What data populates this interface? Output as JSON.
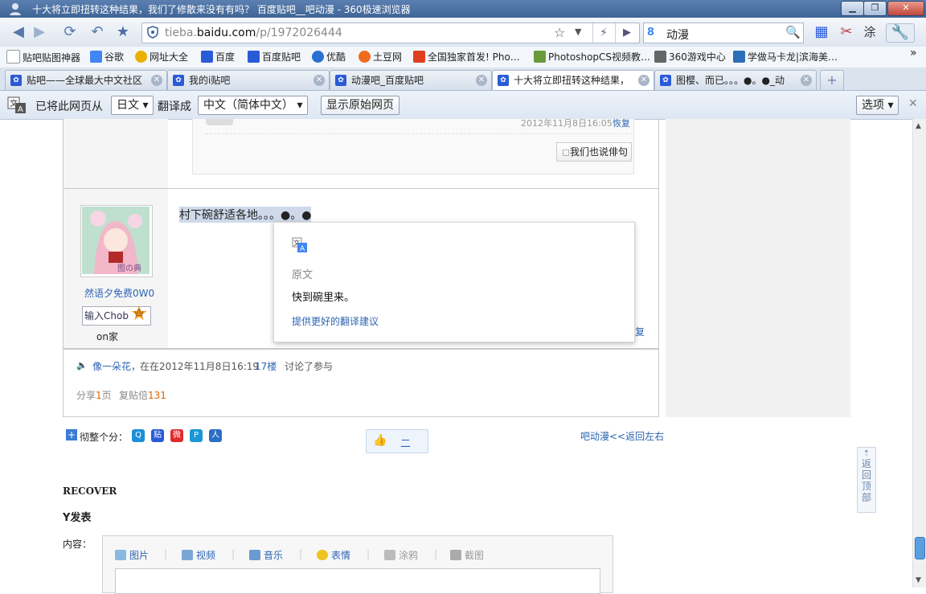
{
  "window": {
    "title": "十大将立即扭转这种结果，我们了修散来没有有吗？ 百度贴吧__吧动漫 - 360极速浏览器",
    "min_label": "▁",
    "max_label": "❐",
    "close_label": "✕"
  },
  "navbar": {
    "url_gray_prefix": "tieba.",
    "url_domain": "baidu.com",
    "url_path": "/p/1972026444",
    "search_engine_letter": "8",
    "search_query": "动漫"
  },
  "bookmarks": [
    {
      "label": "贴吧贴图神器",
      "color": "#ffffff"
    },
    {
      "label": "谷歌",
      "color": "#4285f4"
    },
    {
      "label": "网址大全",
      "color": "#e8b100"
    },
    {
      "label": "百度",
      "color": "#2a5bd7"
    },
    {
      "label": "百度贴吧",
      "color": "#2a5bd7"
    },
    {
      "label": "优酷",
      "color": "#2a6fd4"
    },
    {
      "label": "土豆网",
      "color": "#f26b1d"
    },
    {
      "label": "全国独家首发! Pho…",
      "color": "#e04020"
    },
    {
      "label": "PhotoshopCS视频教…",
      "color": "#6a9b3a"
    },
    {
      "label": "360游戏中心",
      "color": "#666666"
    },
    {
      "label": "学做马卡龙|滨海美…",
      "color": "#2b6fb8"
    }
  ],
  "bookmarks_more": "»",
  "tabs": [
    {
      "label": "贴吧——全球最大中文社区"
    },
    {
      "label": "我的i贴吧"
    },
    {
      "label": "动漫吧_百度贴吧"
    },
    {
      "label": "十大将立即扭转这种结果，"
    },
    {
      "label": "图樱、而已。。。●。●_动"
    }
  ],
  "tab_close": "✕",
  "tab_new": "+",
  "translate_bar": {
    "prefix": "已将此网页从",
    "from_lang": "日文",
    "middle": "翻译成",
    "to_lang": "中文（简体中文）",
    "show_original": "显示原始网页",
    "options": "选项",
    "close": "✕"
  },
  "prev_post": {
    "timestamp": "2012年11月8日16:05",
    "reply": "恢复",
    "say_button": "我们也说俳句"
  },
  "post": {
    "username": "然语夕免费0W0",
    "badge_label": "输入Chob",
    "badge_level": "四",
    "user_note": "on家",
    "text": "村下碗舒适各地。。。●。●",
    "reply_link_fragment": "复"
  },
  "popup": {
    "heading": "原文",
    "original_text": "快到碗里来。",
    "suggest_link": "提供更好的翻译建议"
  },
  "footer_info": {
    "author": "像一朵花，",
    "time_text": "在在2012年11月8日16:19",
    "floor": "17楼",
    "action": "讨论了参与",
    "share_label": "分享",
    "share_count": "1",
    "share_unit": "页",
    "repost_label": "复贴倍",
    "repost_count": "131"
  },
  "share_bar": {
    "label": "彻整个分：",
    "like_count": "二",
    "back_link": "吧动漫<<返回左右"
  },
  "back_to_top": "返回顶部",
  "reply_section": {
    "heading1": "RECOVER",
    "heading2": "Y发表",
    "content_label": "内容：",
    "tools": [
      "图片",
      "视频",
      "音乐",
      "表情",
      "涂鸦",
      "截图"
    ]
  }
}
